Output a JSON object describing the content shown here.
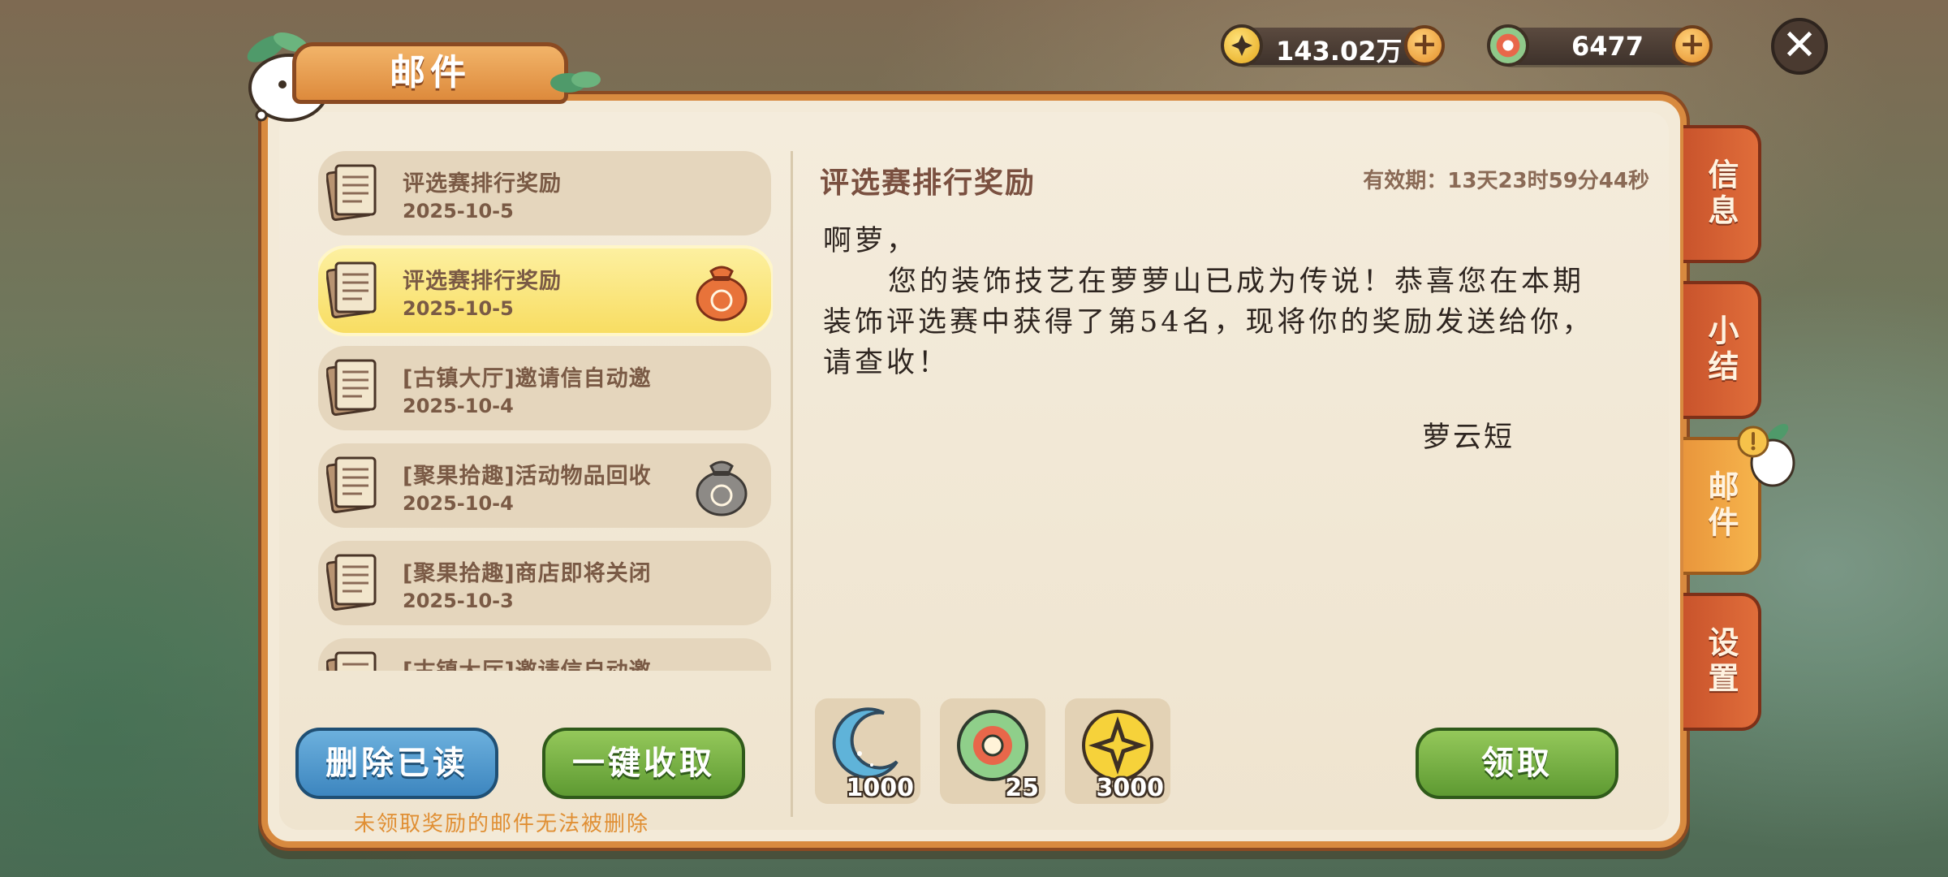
{
  "currency": {
    "coins": "143.02万",
    "jade": "6477"
  },
  "window_title": "邮件",
  "mail_list": [
    {
      "title": "评选赛排行奖励",
      "date": "2025-10-5",
      "selected": false,
      "gift": "none"
    },
    {
      "title": "评选赛排行奖励",
      "date": "2025-10-5",
      "selected": true,
      "gift": "red-gift-bag-icon"
    },
    {
      "title": "[古镇大厅]邀请信自动邀",
      "date": "2025-10-4",
      "selected": false,
      "gift": "none"
    },
    {
      "title": "[聚果拾趣]活动物品回收",
      "date": "2025-10-4",
      "selected": false,
      "gift": "gray-gift-bag-icon"
    },
    {
      "title": "[聚果拾趣]商店即将关闭",
      "date": "2025-10-3",
      "selected": false,
      "gift": "none"
    },
    {
      "title": "[古镇大厅]邀请信自动邀",
      "date": "",
      "selected": false,
      "gift": "none"
    }
  ],
  "buttons": {
    "delete_read": "删除已读",
    "claim_all": "一键收取",
    "claim": "领取"
  },
  "hint": "未领取奖励的邮件无法被删除",
  "detail": {
    "title": "评选赛排行奖励",
    "expire": "有效期：13天23时59分44秒",
    "greeting": "啊萝，",
    "body_line1": "您的装饰技艺在萝萝山已成为传说！恭喜您在本期",
    "body_line2": "装饰评选赛中获得了第54名，现将你的奖励发送给你，",
    "body_line3": "请查收！",
    "signature": "萝云短"
  },
  "rewards": [
    {
      "icon": "moon-gem-icon",
      "count": "1000"
    },
    {
      "icon": "jade-coin-icon",
      "count": "25"
    },
    {
      "icon": "gold-coin-icon",
      "count": "3000"
    }
  ],
  "side_tabs": [
    {
      "label": "信息",
      "active": false
    },
    {
      "label": "小结",
      "active": false
    },
    {
      "label": "邮件",
      "active": true
    },
    {
      "label": "设置",
      "active": false
    }
  ],
  "colors": {
    "panel_border": "#d88a3f",
    "selected_item": "#f8dd62",
    "active_tab": "#f6b44c",
    "inactive_tab": "#e06d3a"
  }
}
